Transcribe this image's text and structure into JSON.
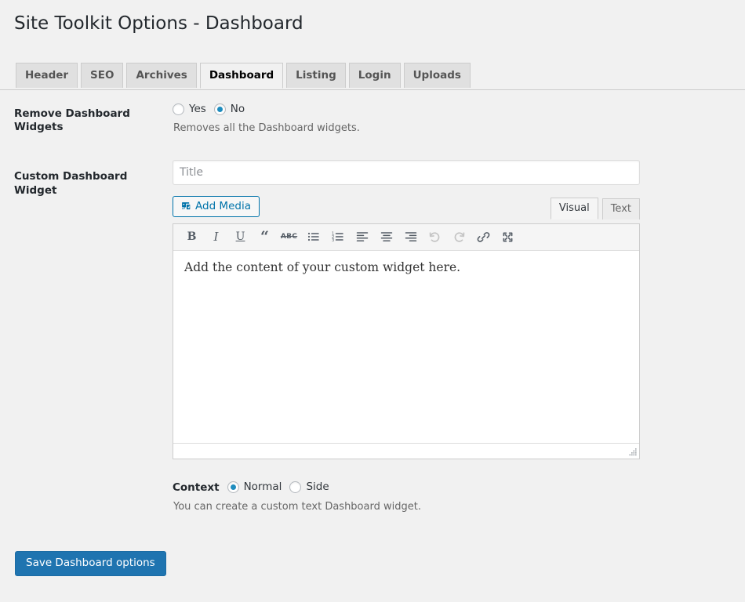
{
  "page": {
    "title": "Site Toolkit Options - Dashboard"
  },
  "tabs": [
    {
      "label": "Header",
      "active": false,
      "name": "tab-header"
    },
    {
      "label": "SEO",
      "active": false,
      "name": "tab-seo"
    },
    {
      "label": "Archives",
      "active": false,
      "name": "tab-archives"
    },
    {
      "label": "Dashboard",
      "active": true,
      "name": "tab-dashboard"
    },
    {
      "label": "Listing",
      "active": false,
      "name": "tab-listing"
    },
    {
      "label": "Login",
      "active": false,
      "name": "tab-login"
    },
    {
      "label": "Uploads",
      "active": false,
      "name": "tab-uploads"
    }
  ],
  "remove_widgets": {
    "label": "Remove Dashboard Widgets",
    "options": [
      {
        "label": "Yes",
        "checked": false
      },
      {
        "label": "No",
        "checked": true
      }
    ],
    "description": "Removes all the Dashboard widgets."
  },
  "custom_widget": {
    "label": "Custom Dashboard Widget",
    "title_placeholder": "Title",
    "title_value": "",
    "add_media_label": "Add Media",
    "add_media_icon": "media-icon",
    "editor_tabs": [
      {
        "label": "Visual",
        "active": true
      },
      {
        "label": "Text",
        "active": false
      }
    ],
    "toolbar": [
      {
        "icon": "bold-icon",
        "glyph": "B",
        "style": "bold",
        "disabled": false
      },
      {
        "icon": "italic-icon",
        "glyph": "I",
        "style": "italic",
        "disabled": false
      },
      {
        "icon": "underline-icon",
        "glyph": "U",
        "style": "under",
        "disabled": false
      },
      {
        "icon": "blockquote-icon",
        "glyph": "“",
        "style": "quote",
        "disabled": false
      },
      {
        "icon": "strikethrough-icon",
        "glyph": "ABC",
        "style": "strike",
        "disabled": false
      },
      {
        "icon": "bulleted-list-icon",
        "glyph": "",
        "style": "svg-ul",
        "disabled": false
      },
      {
        "icon": "numbered-list-icon",
        "glyph": "",
        "style": "svg-ol",
        "disabled": false
      },
      {
        "icon": "align-left-icon",
        "glyph": "",
        "style": "svg-alignleft",
        "disabled": false
      },
      {
        "icon": "align-center-icon",
        "glyph": "",
        "style": "svg-aligncenter",
        "disabled": false
      },
      {
        "icon": "align-right-icon",
        "glyph": "",
        "style": "svg-alignright",
        "disabled": false
      },
      {
        "icon": "undo-icon",
        "glyph": "",
        "style": "svg-undo",
        "disabled": true
      },
      {
        "icon": "redo-icon",
        "glyph": "",
        "style": "svg-redo",
        "disabled": true
      },
      {
        "icon": "link-icon",
        "glyph": "",
        "style": "svg-link",
        "disabled": false
      },
      {
        "icon": "fullscreen-icon",
        "glyph": "",
        "style": "svg-fullscreen",
        "disabled": false
      }
    ],
    "content": "Add the content of your custom widget here."
  },
  "context": {
    "label": "Context",
    "options": [
      {
        "label": "Normal",
        "checked": true
      },
      {
        "label": "Side",
        "checked": false
      }
    ],
    "description": "You can create a custom text Dashboard widget."
  },
  "submit": {
    "label": "Save Dashboard options"
  },
  "colors": {
    "page_background": "#f1f1f1",
    "accent": "#0073aa",
    "radio_dot": "#1e8cbe",
    "primary_button": "#1f74b0",
    "tab_inactive": "#e0e0e0",
    "text": "#23282d",
    "muted_text": "#666666"
  }
}
